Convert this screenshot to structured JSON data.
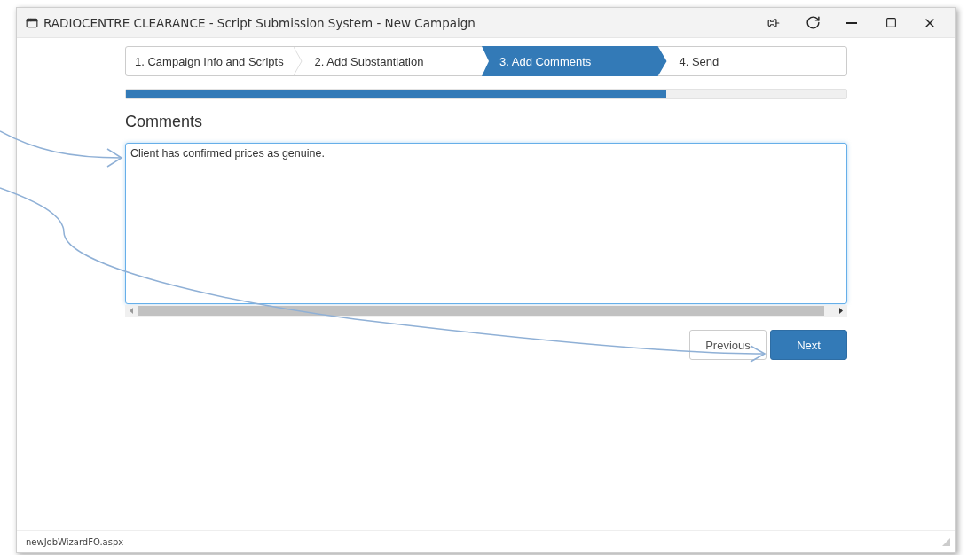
{
  "window": {
    "title": "RADIOCENTRE CLEARANCE - Script Submission System - New Campaign"
  },
  "steps": [
    {
      "label": "1. Campaign Info and Scripts",
      "selected": false
    },
    {
      "label": "2. Add Substantiation",
      "selected": false
    },
    {
      "label": "3. Add Comments",
      "selected": true
    },
    {
      "label": "4. Send",
      "selected": false
    }
  ],
  "progress": {
    "level": 0.75
  },
  "section": {
    "heading": "Comments",
    "value": "Client has confirmed prices as genuine."
  },
  "buttons": [
    {
      "label": "Previous",
      "kind": "secondary"
    },
    {
      "label": "Next",
      "kind": "primary"
    }
  ],
  "status_bar": {
    "text": "newJobWizardFO.aspx"
  }
}
